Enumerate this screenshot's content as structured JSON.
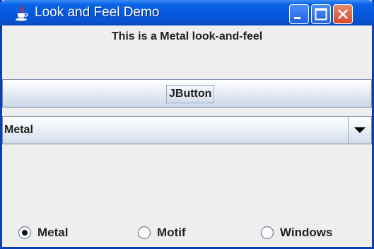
{
  "window": {
    "title": "Look and Feel Demo",
    "title_icon": "java-cup-icon",
    "controls": [
      "minimize-icon",
      "maximize-icon",
      "close-icon"
    ],
    "colors": {
      "titlebar": "#0458dc",
      "close_button": "#d24a2a",
      "content_background": "#eeeeee"
    }
  },
  "content": {
    "header_label": "This is a Metal look-and-feel",
    "button_label": "JButton",
    "combo": {
      "selected": "Metal",
      "arrow_icon": "triangle-down-icon"
    },
    "radios": [
      {
        "label": "Metal",
        "selected": true
      },
      {
        "label": "Motif",
        "selected": false
      },
      {
        "label": "Windows",
        "selected": false
      }
    ]
  }
}
